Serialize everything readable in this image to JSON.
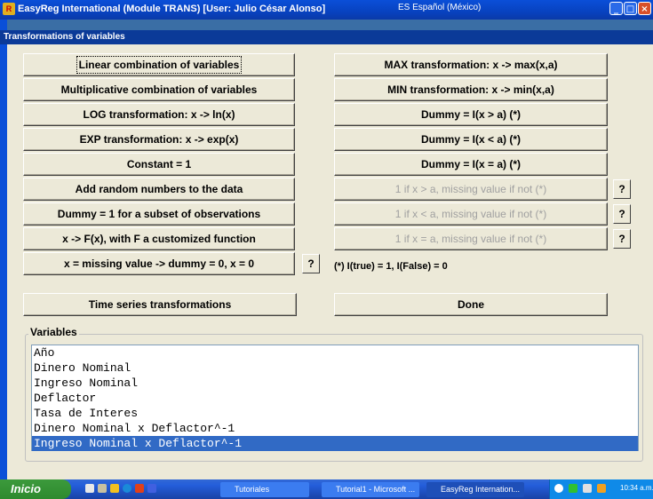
{
  "window": {
    "title": "EasyReg International (Module TRANS) [User: Julio César Alonso]",
    "language": "ES Español (México)",
    "subtitle": "Transformations of variables"
  },
  "left_buttons": [
    "Linear combination of variables",
    "Multiplicative combination of variables",
    "LOG transformation: x -> ln(x)",
    "EXP transformation: x -> exp(x)",
    "Constant  = 1",
    "Add random numbers to the data",
    "Dummy = 1 for a subset of observations",
    "x -> F(x), with F a customized function",
    "x = missing value -> dummy = 0, x = 0"
  ],
  "right_buttons": [
    "MAX transformation: x -> max(x,a)",
    "MIN transformation: x -> min(x,a)",
    "Dummy =  I(x > a)  (*)",
    "Dummy = I(x < a)  (*)",
    "Dummy = I(x = a) (*)",
    "1 if x > a, missing value if not (*)",
    "1 if x < a, missing value if not (*)",
    "1 if x = a, missing value if not (*)"
  ],
  "help_label": "?",
  "note": "(*) I(true) = 1, I(False) = 0",
  "time_series_label": "Time series transformations",
  "done_label": "Done",
  "variables": {
    "label": "Variables",
    "items": [
      "Año",
      "Dinero Nominal",
      "Ingreso Nominal",
      "Deflactor",
      "Tasa de Interes",
      "Dinero Nominal x Deflactor^-1",
      "Ingreso Nominal x Deflactor^-1"
    ],
    "selected_index": 6
  },
  "taskbar": {
    "start_label": "Inicio",
    "tasks": [
      "Tutoriales",
      "Tutorial1 - Microsoft ...",
      "EasyReg Internation..."
    ],
    "clock": "10:34 a.m."
  },
  "colors": {
    "titlebar": "#0a4fd8",
    "selection": "#316ac5",
    "face": "#ece9d8"
  }
}
